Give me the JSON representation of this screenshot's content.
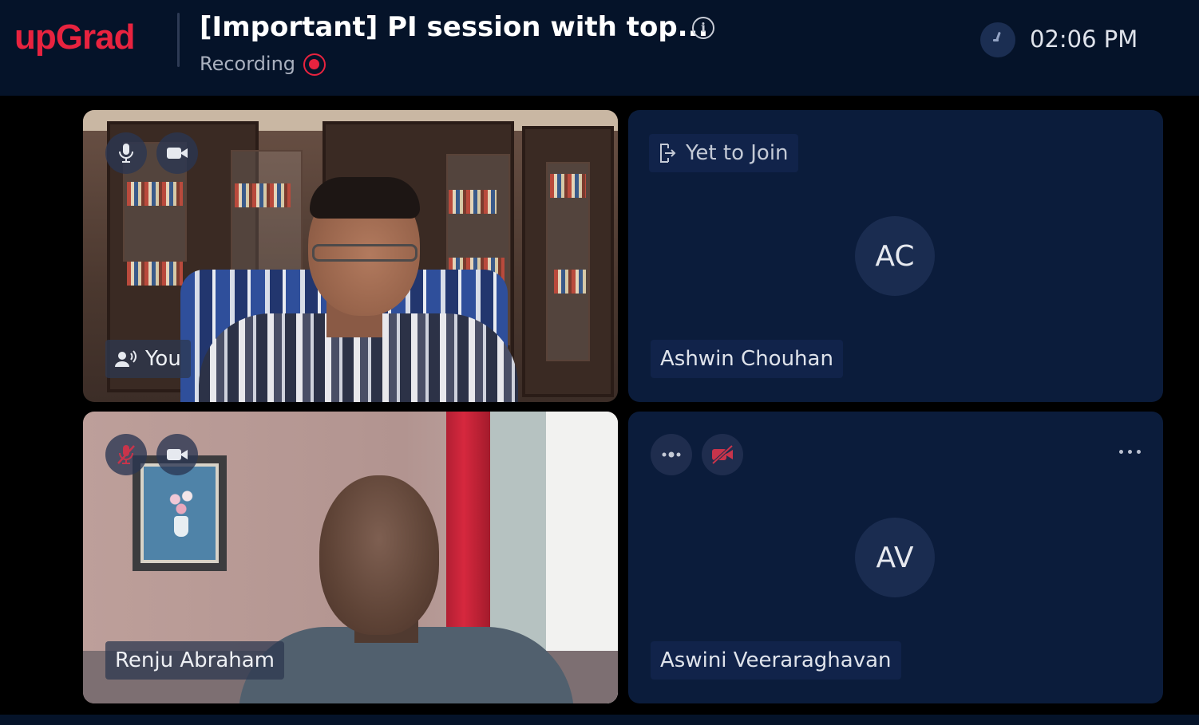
{
  "header": {
    "logo": "upGrad",
    "title": "[Important] PI session with top...",
    "recording_label": "Recording",
    "time": "02:06 PM"
  },
  "tiles": [
    {
      "type": "video",
      "name": "You",
      "mic": "on",
      "camera": "on"
    },
    {
      "type": "avatar",
      "status": "Yet to Join",
      "initials": "AC",
      "name": "Ashwin Chouhan"
    },
    {
      "type": "video",
      "name": "Renju Abraham",
      "mic": "muted",
      "camera": "on"
    },
    {
      "type": "avatar",
      "initials": "AV",
      "name": "Aswini Veeraraghavan",
      "mic": "speaking",
      "camera": "off"
    }
  ],
  "colors": {
    "brand_red": "#e8233f",
    "header_bg": "#051329",
    "tile_bg": "#0b1c3b",
    "avatar_circle": "#1a2c50"
  },
  "icons": {
    "info": "info-icon",
    "recording": "recording-dot-icon",
    "clock": "clock-icon",
    "mic": "microphone-icon",
    "mic_muted": "microphone-muted-icon",
    "camera": "video-camera-icon",
    "camera_off": "video-camera-off-icon",
    "speaker": "speaking-user-icon",
    "join": "exit-door-icon",
    "more": "more-options-icon"
  }
}
